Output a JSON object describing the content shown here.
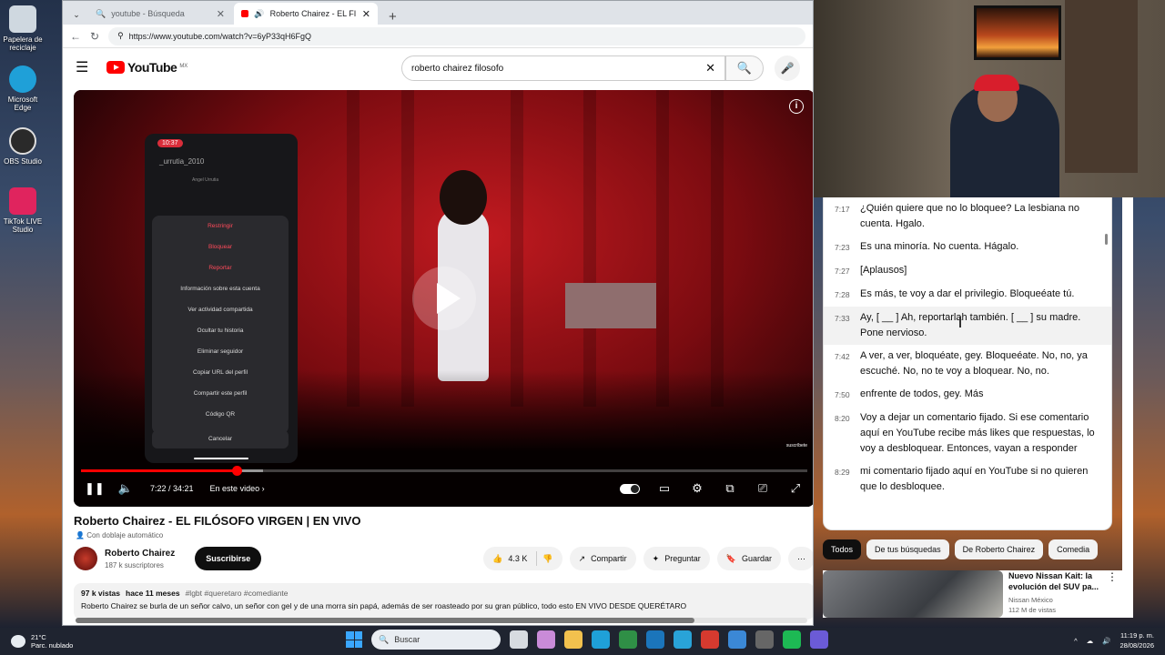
{
  "desktop": {
    "icons": [
      {
        "label": "Papelera de reciclaje",
        "color": "#cfd8e0"
      },
      {
        "label": "Microsoft Edge",
        "color": "#1fa0d8"
      },
      {
        "label": "OBS Studio",
        "color": "#2a2a2a"
      },
      {
        "label": "TikTok LIVE Studio",
        "color": "#e0245e"
      }
    ]
  },
  "browser": {
    "tabs": [
      {
        "label": "youtube - Búsqueda",
        "active": false
      },
      {
        "label": "Roberto Chairez - EL FILÓSOF",
        "active": true
      }
    ],
    "url": "https://www.youtube.com/watch?v=6yP33qH6FgQ"
  },
  "youtube": {
    "logo_text": "YouTube",
    "region": "MX",
    "search_value": "roberto chairez filosofo",
    "player": {
      "current_time": "7:22",
      "duration": "34:21",
      "time_display": "7:22 / 34:21",
      "in_video_label": "En este video",
      "progress_fraction": 0.214,
      "buffered_fraction": 0.25,
      "watermark": "suscríbete",
      "phone": {
        "time": "10:37",
        "username": "_urrutia_2010",
        "profile_name": "Angel Urrutia",
        "menu_items": [
          {
            "label": "Restringir",
            "red": true
          },
          {
            "label": "Bloquear",
            "red": true
          },
          {
            "label": "Reportar",
            "red": true
          },
          {
            "label": "Información sobre esta cuenta",
            "red": false
          },
          {
            "label": "Ver actividad compartida",
            "red": false
          },
          {
            "label": "Ocultar tu historia",
            "red": false
          },
          {
            "label": "Eliminar seguidor",
            "red": false
          },
          {
            "label": "Copiar URL del perfil",
            "red": false
          },
          {
            "label": "Compartir este perfil",
            "red": false
          },
          {
            "label": "Código QR",
            "red": false
          }
        ],
        "cancel": "Cancelar"
      }
    },
    "video_title": "Roberto Chairez - EL FILÓSOFO VIRGEN | EN VIVO",
    "dub_label": "Con doblaje automático",
    "channel": {
      "name": "Roberto Chairez",
      "subscribers": "187 k suscriptores",
      "subscribe_label": "Suscribirse"
    },
    "actions": {
      "likes": "4.3 K",
      "share": "Compartir",
      "ask": "Preguntar",
      "save": "Guardar"
    },
    "description": {
      "views": "97 k vistas",
      "age": "hace 11 meses",
      "tags": "#lgbt #queretaro #comediante",
      "text": "Roberto Chairez se burla de un señor calvo, un señor con gel y de una morra sin papá, además de ser roasteado por su gran público, todo esto EN VIVO DESDE QUERÉTARO"
    },
    "transcript": [
      {
        "time": "7:17",
        "text": "¿Quién quiere que no lo bloquee? La lesbiana no cuenta. Hgalo.",
        "highlight": false
      },
      {
        "time": "7:23",
        "text": "Es una minoría. No cuenta. Hágalo.",
        "highlight": false
      },
      {
        "time": "7:27",
        "text": "[Aplausos]",
        "highlight": false
      },
      {
        "time": "7:28",
        "text": "Es más, te voy a dar el privilegio. Bloqueéate tú.",
        "highlight": false
      },
      {
        "time": "7:33",
        "text": "Ay, [ __ ] Ah, reportarlah también. [ __ ] su madre. Pone nervioso.",
        "highlight": true
      },
      {
        "time": "7:42",
        "text": "A ver, a ver, bloquéate, gey. Bloqueéate. No, no, ya escuché. No, no te voy a bloquear. No, no.",
        "highlight": false
      },
      {
        "time": "7:50",
        "text": "enfrente de todos, gey. Más",
        "highlight": false
      },
      {
        "time": "8:20",
        "text": "Voy a dejar un comentario fijado. Si ese comentario aquí en YouTube recibe más likes que respuestas, lo voy a desbloquear. Entonces, vayan a responder",
        "highlight": false
      },
      {
        "time": "8:29",
        "text": "mi comentario fijado aquí en YouTube si no quieren que lo desbloquee.",
        "highlight": false
      }
    ],
    "chips": [
      {
        "label": "Todos",
        "active": true
      },
      {
        "label": "De tus búsquedas",
        "active": false
      },
      {
        "label": "De Roberto Chairez",
        "active": false
      },
      {
        "label": "Comedia",
        "active": false
      }
    ],
    "recommendation": {
      "title": "Nuevo Nissan Kait: la evolución del SUV pa...",
      "channel": "Nissan México",
      "views": "112 M de vistas"
    }
  },
  "taskbar": {
    "temperature": "21°C",
    "weather": "Parc. nublado",
    "search_placeholder": "Buscar",
    "time": "11:19 p. m.",
    "date": "28/08/2026",
    "apps": [
      "#d7dbe0",
      "#c98bd8",
      "#f2c14e",
      "#1fa0d8",
      "#2f8f46",
      "#1b75bb",
      "#29a3d8",
      "#d63a2f",
      "#3b88d6",
      "#666666",
      "#1db954",
      "#6b5bd6"
    ]
  }
}
